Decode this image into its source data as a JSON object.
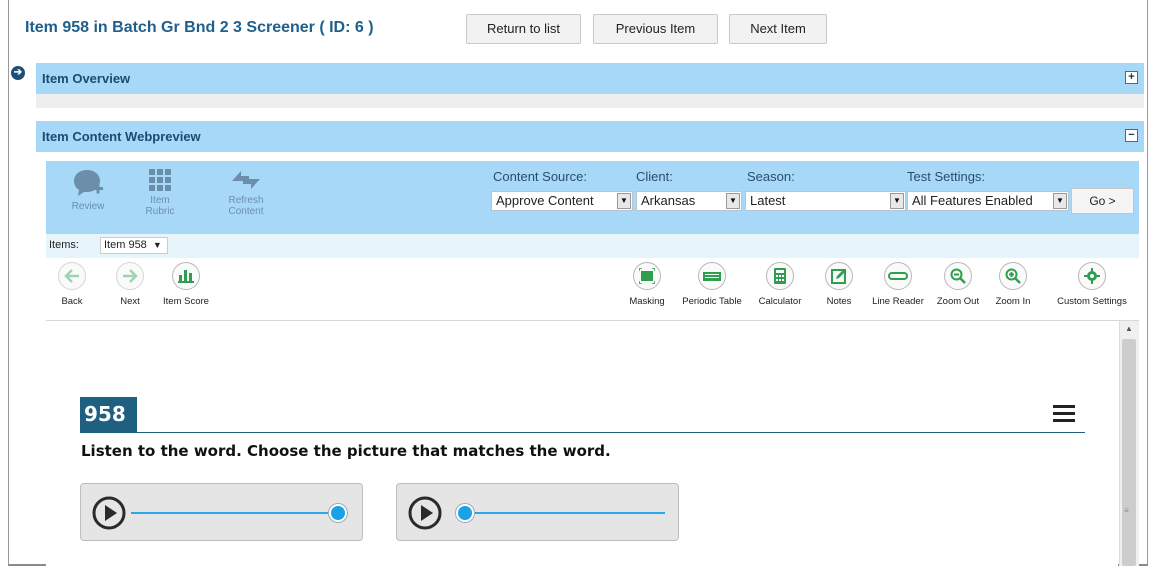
{
  "header": {
    "title": "Item 958 in Batch Gr Bnd 2 3 Screener ( ID: 6 )",
    "return_label": "Return to list",
    "previous_label": "Previous Item",
    "next_label": "Next Item"
  },
  "overview": {
    "title": "Item Overview",
    "toggle": "+"
  },
  "webpreview": {
    "title": "Item Content Webpreview",
    "toggle": "−"
  },
  "toolbar": {
    "review_label": "Review",
    "rubric_label": "Item\nRubric",
    "rubric_line1": "Item",
    "rubric_line2": "Rubric",
    "refresh_line1": "Refresh",
    "refresh_line2": "Content",
    "content_source_label": "Content Source:",
    "content_source_value": "Approve Content",
    "client_label": "Client:",
    "client_value": "Arkansas",
    "season_label": "Season:",
    "season_value": "Latest",
    "test_settings_label": "Test Settings:",
    "test_settings_value": "All Features Enabled",
    "go_label": "Go >"
  },
  "items": {
    "label": "Items:",
    "value": "Item 958"
  },
  "nav_tools": {
    "back": "Back",
    "next": "Next",
    "item_score": "Item Score"
  },
  "tools": {
    "masking": "Masking",
    "periodic_table": "Periodic Table",
    "calculator": "Calculator",
    "notes": "Notes",
    "line_reader": "Line Reader",
    "zoom_out": "Zoom Out",
    "zoom_in": "Zoom In",
    "custom_settings": "Custom Settings"
  },
  "question": {
    "number": "958",
    "prompt": "Listen to the word. Choose the picture that matches the word.",
    "audio": [
      {
        "progress": 1.0
      },
      {
        "progress": 0.0
      }
    ]
  },
  "colors": {
    "header_blue": "#a8d8f8",
    "title_blue": "#1f5f8b",
    "tool_green": "#2e9e4f",
    "accent_knob": "#1ba1e8"
  }
}
